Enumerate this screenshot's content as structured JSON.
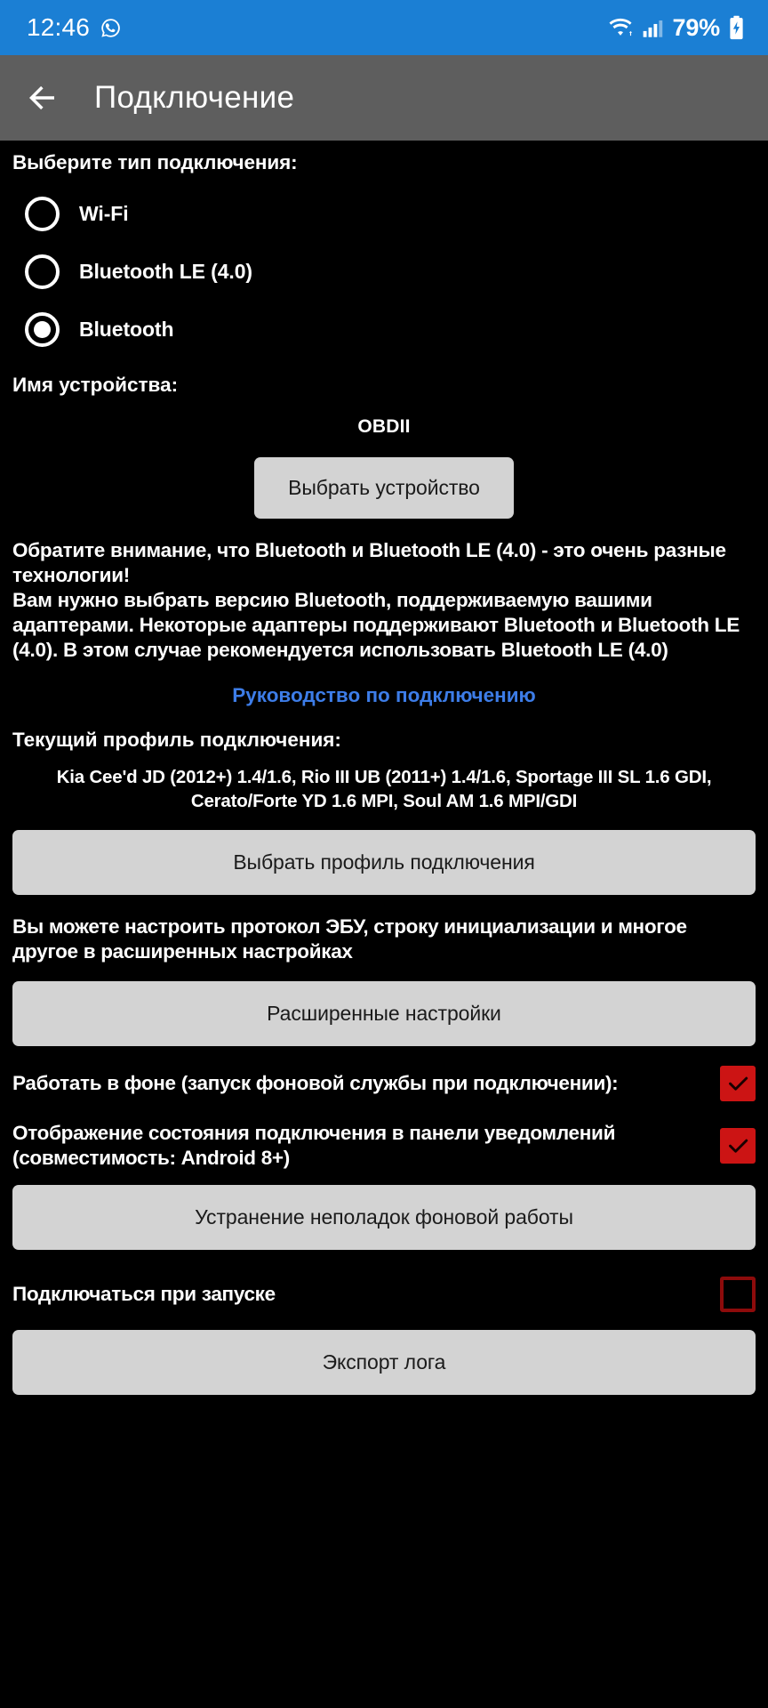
{
  "status_bar": {
    "clock": "12:46",
    "whatsapp_icon": "whatsapp-icon",
    "wifi_icon": "wifi-icon",
    "signal_icon": "cellular-signal-icon",
    "battery_percent": "79%",
    "battery_icon": "battery-charging-icon",
    "background_color": "#1b7fd4"
  },
  "toolbar": {
    "back_icon": "back-arrow-icon",
    "title": "Подключение",
    "background_color": "#5e5e5e"
  },
  "connection_type": {
    "label": "Выберите тип подключения:",
    "options": [
      {
        "label": "Wi-Fi",
        "selected": false
      },
      {
        "label": "Bluetooth LE (4.0)",
        "selected": false
      },
      {
        "label": "Bluetooth",
        "selected": true
      }
    ]
  },
  "device": {
    "label": "Имя устройства:",
    "name": "OBDII",
    "select_button": "Выбрать устройство"
  },
  "notice": {
    "line1": "Обратите внимание, что Bluetooth и Bluetooth LE (4.0) - это очень разные технологии!",
    "line2": "Вам нужно выбрать версию Bluetooth, поддерживаемую вашими адаптерами. Некоторые адаптеры поддерживают Bluetooth и Bluetooth LE (4.0). В этом случае рекомендуется использовать Bluetooth LE (4.0)"
  },
  "guide_link": {
    "label": "Руководство по подключению",
    "color": "#3d7de8"
  },
  "profile": {
    "heading": "Текущий профиль подключения:",
    "value": "Kia Cee'd JD (2012+) 1.4/1.6, Rio III UB (2011+) 1.4/1.6, Sportage III SL 1.6 GDI, Cerato/Forte YD 1.6 MPI, Soul AM 1.6 MPI/GDI",
    "select_button": "Выбрать профиль подключения"
  },
  "advanced": {
    "hint": "Вы можете настроить протокол ЭБУ, строку инициализации и многое другое в расширенных настройках",
    "button": "Расширенные настройки"
  },
  "toggles": [
    {
      "label": "Работать в фоне (запуск фоновой службы при подключении):",
      "checked": true,
      "name": "background-service-checkbox"
    },
    {
      "label": "Отображение состояния подключения в панели уведомлений (совместимость: Android 8+)",
      "checked": true,
      "name": "notification-status-checkbox"
    }
  ],
  "troubleshoot_button": "Устранение неполадок фоновой работы",
  "startup": {
    "label": "Подключаться при запуске",
    "checked": false
  },
  "export_button": "Экспорт лога",
  "colors": {
    "accent_blue": "#1b7fd4",
    "checkbox_checked": "#cc1414",
    "checkbox_unchecked_border": "#8d0b0b",
    "button_bg": "#d3d3d3",
    "page_bg": "#000000"
  }
}
